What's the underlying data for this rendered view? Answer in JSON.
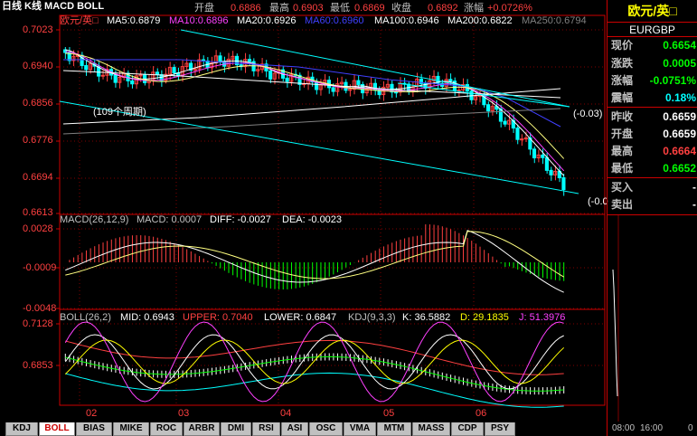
{
  "header": {
    "title": "日线 K线 MACD BOLL",
    "quote": [
      {
        "label": "开盘",
        "value": "0.6886"
      },
      {
        "label": "最高",
        "value": "0.6903"
      },
      {
        "label": "最低",
        "value": "0.6869"
      },
      {
        "label": "收盘",
        "value": "0.6892"
      },
      {
        "label": "涨幅",
        "value": "+0.0726%"
      }
    ]
  },
  "main_legend": {
    "symbol": "欧元/英□",
    "items": [
      {
        "label": "MA5:",
        "value": "0.6879",
        "color": "#ffffff"
      },
      {
        "label": "MA10:",
        "value": "0.6896",
        "color": "#ff40ff"
      },
      {
        "label": "MA20:",
        "value": "0.6926",
        "color": "#ffffff"
      },
      {
        "label": "MA60:",
        "value": "0.6960",
        "color": "#4040ff"
      },
      {
        "label": "MA100:",
        "value": "0.6946",
        "color": "#ffffff"
      },
      {
        "label": "MA200:",
        "value": "0.6822",
        "color": "#ffffff"
      },
      {
        "label": "MA250:",
        "value": "0.6794",
        "color": "#808080"
      }
    ]
  },
  "main_axis": [
    "0.7023",
    "0.6940",
    "0.6856",
    "0.6776",
    "0.6694",
    "0.6613"
  ],
  "annotations": {
    "period": "(109个周期)",
    "line1": "(-0.03)",
    "line2": "(-0.0"
  },
  "macd_legend": {
    "name": "MACD(26,12,9)",
    "macd": "MACD: 0.0007",
    "diff": "DIFF: -0.0027",
    "dea": "DEA: -0.0023"
  },
  "macd_axis": [
    "0.0028",
    "-0.0009",
    "-0.0048"
  ],
  "boll_legend": {
    "name": "BOLL(26,2)",
    "mid": "MID: 0.6943",
    "upper": "UPPER: 0.7040",
    "lower": "LOWER: 0.6847",
    "kdj": "KDJ(9,3,3)",
    "k": "K: 36.5882",
    "d": "D: 29.1835",
    "j": "J: 51.3976"
  },
  "boll_axis": [
    "0.7128",
    "0.6853"
  ],
  "x_axis": [
    "02",
    "03",
    "04",
    "05",
    "06"
  ],
  "tabs": [
    "KDJ",
    "BOLL",
    "BIAS",
    "MIKE",
    "ROC",
    "ARBR",
    "DMI",
    "RSI",
    "ASI",
    "OSC",
    "VMA",
    "MTM",
    "MASS",
    "CDP",
    "PSY"
  ],
  "active_tab": "BOLL",
  "side_panel": {
    "title": "欧元/英□",
    "code": "EURGBP",
    "rows": [
      {
        "label": "现价",
        "value": "0.6654",
        "color": "#00ff00"
      },
      {
        "label": "涨跌",
        "value": "0.0005",
        "color": "#00ff00"
      },
      {
        "label": "涨幅",
        "value": "-0.0751%",
        "color": "#00ff00"
      },
      {
        "label": "震幅",
        "value": "0.18%",
        "color": "#00ffff"
      },
      {
        "label": "昨收",
        "value": "0.6659",
        "color": "#ffffff"
      },
      {
        "label": "开盘",
        "value": "0.6659",
        "color": "#ffffff"
      },
      {
        "label": "最高",
        "value": "0.6664",
        "color": "#ff4040"
      },
      {
        "label": "最低",
        "value": "0.6652",
        "color": "#00ff00"
      }
    ],
    "buy": "买入",
    "sell": "卖出",
    "buy_value": "-",
    "sell_value": "-",
    "time_start": "08:00",
    "time_end": "16:00",
    "time_cut": "0"
  }
}
